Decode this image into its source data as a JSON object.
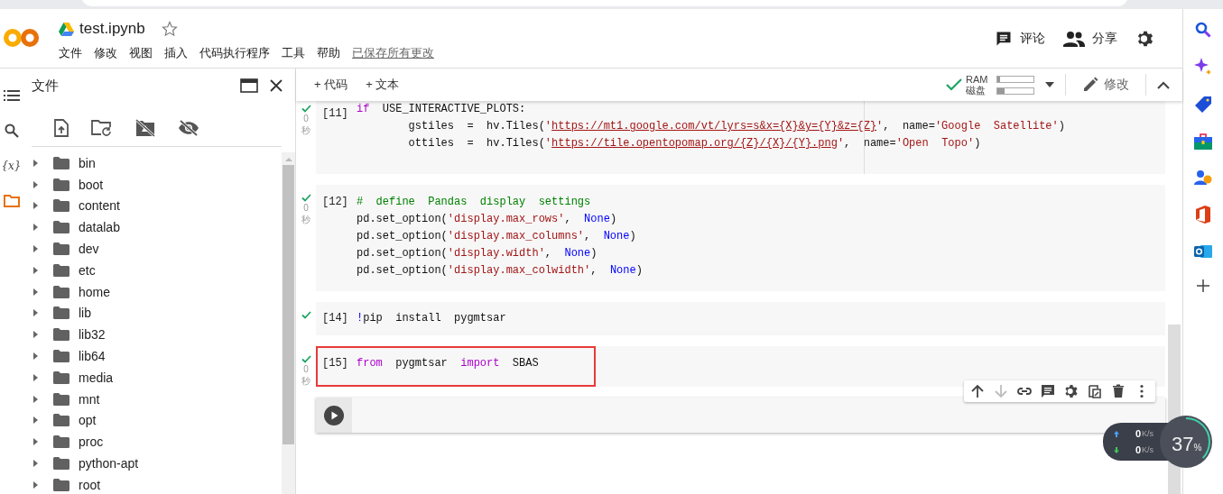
{
  "header": {
    "title": "test.ipynb",
    "starred": false,
    "menu": [
      "文件",
      "修改",
      "视图",
      "插入",
      "代码执行程序",
      "工具",
      "帮助"
    ],
    "saved_status": "已保存所有更改",
    "actions": [
      {
        "kind": "comment",
        "label": "评论"
      },
      {
        "kind": "share",
        "label": "分享"
      },
      {
        "kind": "settings"
      }
    ]
  },
  "rail": [
    {
      "kind": "toc",
      "selected": false
    },
    {
      "kind": "search",
      "selected": false
    },
    {
      "kind": "vars",
      "glyph": "{x}",
      "selected": false
    },
    {
      "kind": "files",
      "selected": true
    }
  ],
  "file_panel": {
    "title": "文件",
    "tools": [
      {
        "kind": "upload"
      },
      {
        "kind": "refresh"
      },
      {
        "kind": "driveoff"
      },
      {
        "kind": "hide"
      }
    ],
    "tree": [
      {
        "name": "bin",
        "expanded": false
      },
      {
        "name": "boot",
        "expanded": false
      },
      {
        "name": "content",
        "expanded": false
      },
      {
        "name": "datalab",
        "expanded": false
      },
      {
        "name": "dev",
        "expanded": false
      },
      {
        "name": "etc",
        "expanded": false
      },
      {
        "name": "home",
        "expanded": false
      },
      {
        "name": "lib",
        "expanded": false
      },
      {
        "name": "lib32",
        "expanded": false
      },
      {
        "name": "lib64",
        "expanded": false
      },
      {
        "name": "media",
        "expanded": false
      },
      {
        "name": "mnt",
        "expanded": false
      },
      {
        "name": "opt",
        "expanded": false
      },
      {
        "name": "proc",
        "expanded": false
      },
      {
        "name": "python-apt",
        "expanded": false
      },
      {
        "name": "root",
        "expanded": false
      }
    ]
  },
  "toolbar": {
    "add": [
      {
        "sign": "+",
        "label": "代码"
      },
      {
        "sign": "+",
        "label": "文本"
      }
    ],
    "connected": true,
    "resources": [
      {
        "label": "RAM",
        "level": 0.08
      },
      {
        "label": "磁盘",
        "level": 0.2
      }
    ],
    "edit": "修改"
  },
  "cells": [
    {
      "prompt": "[11]",
      "done": true,
      "time": "0",
      "unit": "秒",
      "highlighted": false,
      "ruler": true,
      "lines": [
        [
          {
            "kind": "kw",
            "text": "if"
          },
          {
            "kind": "plain",
            "text": "  USE_INTERACTIVE_PLOTS:"
          }
        ],
        [
          {
            "kind": "plain",
            "text": "        gstiles  =  hv.Tiles("
          },
          {
            "kind": "str",
            "text": "'"
          },
          {
            "kind": "link",
            "text": "https://mt1.google.com/vt/lyrs=s&x={X}&y={Y}&z={Z}"
          },
          {
            "kind": "str",
            "text": "'"
          },
          {
            "kind": "plain",
            "text": ",  name="
          },
          {
            "kind": "str",
            "text": "'Google  Satellite'"
          },
          {
            "kind": "plain",
            "text": ")"
          }
        ],
        [
          {
            "kind": "plain",
            "text": "        ottiles  =  hv.Tiles("
          },
          {
            "kind": "str",
            "text": "'"
          },
          {
            "kind": "link",
            "text": "https://tile.opentopomap.org/{Z}/{X}/{Y}.png"
          },
          {
            "kind": "str",
            "text": "'"
          },
          {
            "kind": "plain",
            "text": ",  name="
          },
          {
            "kind": "str",
            "text": "'Open  Topo'"
          },
          {
            "kind": "plain",
            "text": ")"
          }
        ]
      ]
    },
    {
      "prompt": "[12]",
      "done": true,
      "time": "0",
      "unit": "秒",
      "highlighted": false,
      "ruler": false,
      "lines": [
        [
          {
            "kind": "cmt",
            "text": "#  define  Pandas  display  settings"
          }
        ],
        [
          {
            "kind": "plain",
            "text": "pd.set_option("
          },
          {
            "kind": "str",
            "text": "'display.max_rows'"
          },
          {
            "kind": "plain",
            "text": ",  "
          },
          {
            "kind": "const",
            "text": "None"
          },
          {
            "kind": "plain",
            "text": ")"
          }
        ],
        [
          {
            "kind": "plain",
            "text": "pd.set_option("
          },
          {
            "kind": "str",
            "text": "'display.max_columns'"
          },
          {
            "kind": "plain",
            "text": ",  "
          },
          {
            "kind": "const",
            "text": "None"
          },
          {
            "kind": "plain",
            "text": ")"
          }
        ],
        [
          {
            "kind": "plain",
            "text": "pd.set_option("
          },
          {
            "kind": "str",
            "text": "'display.width'"
          },
          {
            "kind": "plain",
            "text": ",  "
          },
          {
            "kind": "const",
            "text": "None"
          },
          {
            "kind": "plain",
            "text": ")"
          }
        ],
        [
          {
            "kind": "plain",
            "text": "pd.set_option("
          },
          {
            "kind": "str",
            "text": "'display.max_colwidth'"
          },
          {
            "kind": "plain",
            "text": ",  "
          },
          {
            "kind": "const",
            "text": "None"
          },
          {
            "kind": "plain",
            "text": ")"
          }
        ]
      ]
    },
    {
      "prompt": "[14]",
      "done": true,
      "highlighted": false,
      "ruler": false,
      "lines": [
        [
          {
            "kind": "const",
            "text": "!"
          },
          {
            "kind": "plain",
            "text": "pip  install  pygmtsar"
          }
        ]
      ]
    },
    {
      "prompt": "[15]",
      "done": true,
      "time": "0",
      "unit": "秒",
      "highlighted": true,
      "ruler": false,
      "lines": [
        [
          {
            "kind": "kw",
            "text": "from"
          },
          {
            "kind": "plain",
            "text": "  pygmtsar  "
          },
          {
            "kind": "kw",
            "text": "import"
          },
          {
            "kind": "plain",
            "text": "  SBAS"
          }
        ]
      ]
    }
  ],
  "cell_tools": [
    {
      "kind": "up",
      "disabled": false
    },
    {
      "kind": "down",
      "disabled": true
    },
    {
      "kind": "link",
      "disabled": false
    },
    {
      "kind": "comment",
      "disabled": false
    },
    {
      "kind": "settings",
      "disabled": false
    },
    {
      "kind": "mirror",
      "disabled": false
    },
    {
      "kind": "delete",
      "disabled": false
    },
    {
      "kind": "more",
      "disabled": false
    }
  ],
  "net_monitor": {
    "up": "0",
    "up_unit": "K/s",
    "down": "0",
    "down_unit": "K/s",
    "percent": "37",
    "percent_sign": "%",
    "level": 0.37
  },
  "extensions": [
    {
      "kind": "search"
    },
    {
      "kind": "sparkle"
    },
    {
      "kind": "tag"
    },
    {
      "kind": "toolbox"
    },
    {
      "kind": "people"
    },
    {
      "kind": "office"
    },
    {
      "kind": "outlook"
    },
    {
      "kind": "add"
    }
  ]
}
